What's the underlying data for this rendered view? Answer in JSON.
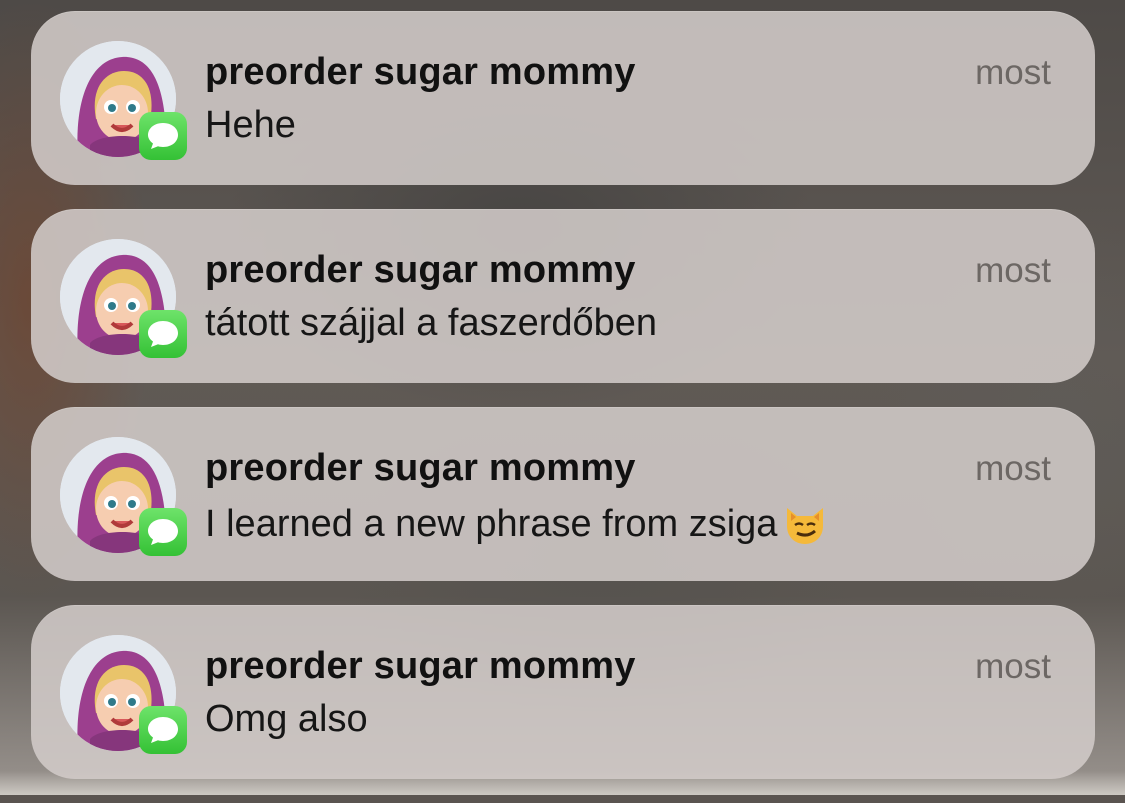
{
  "notifications": [
    {
      "sender": "preorder sugar mommy",
      "time": "most",
      "message": "Hehe",
      "emoji": ""
    },
    {
      "sender": "preorder sugar mommy",
      "time": "most",
      "message": "tátott szájjal a faszerdőben",
      "emoji": ""
    },
    {
      "sender": "preorder sugar mommy",
      "time": "most",
      "message": "I learned a new phrase from zsiga",
      "emoji": "smirking-cat-emoji"
    },
    {
      "sender": "preorder sugar mommy",
      "time": "most",
      "message": "Omg also",
      "emoji": ""
    }
  ],
  "app_icon": "messages-icon",
  "colors": {
    "badge_green": "#34c135",
    "card_background": "#d2cbc8",
    "time_gray": "#6c6764"
  }
}
